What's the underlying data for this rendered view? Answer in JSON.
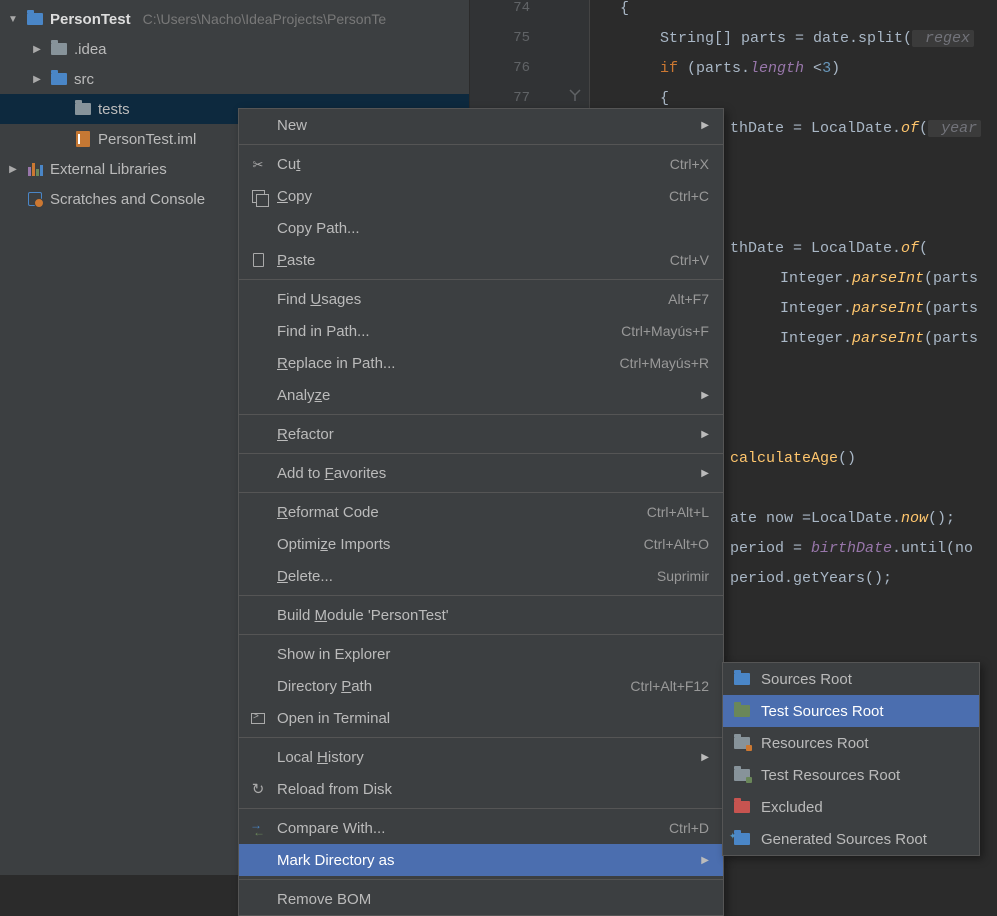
{
  "tree": {
    "root": {
      "name": "PersonTest",
      "path": "C:\\Users\\Nacho\\IdeaProjects\\PersonTe"
    },
    "items": [
      {
        "name": ".idea"
      },
      {
        "name": "src"
      },
      {
        "name": "tests"
      },
      {
        "name": "PersonTest.iml"
      }
    ],
    "libs": "External Libraries",
    "scratches": "Scratches and Console"
  },
  "gutter": {
    "ln74": "74",
    "ln75": "75",
    "ln76": "76",
    "ln77": "77"
  },
  "code": {
    "l74": {
      "brace": "{"
    },
    "l75": {
      "a": "String[] parts = date.split(",
      "hint": " regex"
    },
    "l76": {
      "kw": "if",
      "a": " (parts.",
      "field": "length",
      "b": " <",
      "num": "3",
      "c": ")"
    },
    "l77": {
      "brace": "{"
    },
    "l78": {
      "a": "thDate = LocalDate.",
      "fn": "of",
      "b": "(",
      "hint": " year"
    },
    "l82": {
      "a": "thDate = LocalDate.",
      "fn": "of",
      "b": "("
    },
    "l83": {
      "a": "Integer.",
      "fn": "parseInt",
      "b": "(parts"
    },
    "l84": {
      "a": "Integer.",
      "fn": "parseInt",
      "b": "(parts"
    },
    "l85": {
      "a": "Integer.",
      "fn": "parseInt",
      "b": "(parts"
    },
    "l90": {
      "fn": "calculateAge",
      "a": "()"
    },
    "l92": {
      "a": "ate now =LocalDate.",
      "fn": "now",
      "b": "();"
    },
    "l93": {
      "a": "period = ",
      "field": "birthDate",
      "b": ".until(no"
    },
    "l94": {
      "a": "period.getYears();"
    }
  },
  "menu": [
    {
      "type": "item",
      "label": "New",
      "sub": true
    },
    {
      "type": "sep"
    },
    {
      "type": "item",
      "label": "Cut",
      "mn": "t",
      "icon": "mi-cut",
      "sc": "Ctrl+X"
    },
    {
      "type": "item",
      "label": "Copy",
      "mn": "C",
      "icon": "mi-copy",
      "sc": "Ctrl+C"
    },
    {
      "type": "item",
      "label": "Copy Path...",
      "mn": ""
    },
    {
      "type": "item",
      "label": "Paste",
      "mn": "P",
      "icon": "mi-paste",
      "sc": "Ctrl+V"
    },
    {
      "type": "sep"
    },
    {
      "type": "item",
      "label": "Find Usages",
      "mn": "U",
      "sc": "Alt+F7"
    },
    {
      "type": "item",
      "label": "Find in Path...",
      "mn": "",
      "sc": "Ctrl+Mayús+F"
    },
    {
      "type": "item",
      "label": "Replace in Path...",
      "mn": "R",
      "sc": "Ctrl+Mayús+R"
    },
    {
      "type": "item",
      "label": "Analyze",
      "mn": "z",
      "sub": true
    },
    {
      "type": "sep"
    },
    {
      "type": "item",
      "label": "Refactor",
      "mn": "R",
      "sub": true
    },
    {
      "type": "sep"
    },
    {
      "type": "item",
      "label": "Add to Favorites",
      "mn": "F",
      "sub": true
    },
    {
      "type": "sep"
    },
    {
      "type": "item",
      "label": "Reformat Code",
      "mn": "R",
      "sc": "Ctrl+Alt+L"
    },
    {
      "type": "item",
      "label": "Optimize Imports",
      "mn": "z",
      "sc": "Ctrl+Alt+O"
    },
    {
      "type": "item",
      "label": "Delete...",
      "mn": "D",
      "sc": "Suprimir"
    },
    {
      "type": "sep"
    },
    {
      "type": "item",
      "label": "Build Module 'PersonTest'",
      "mn": "M"
    },
    {
      "type": "sep"
    },
    {
      "type": "item",
      "label": "Show in Explorer",
      "mn": ""
    },
    {
      "type": "item",
      "label": "Directory Path",
      "mn": "P",
      "sc": "Ctrl+Alt+F12"
    },
    {
      "type": "item",
      "label": "Open in Terminal",
      "icon": "mi-terminal"
    },
    {
      "type": "sep"
    },
    {
      "type": "item",
      "label": "Local History",
      "mn": "H",
      "sub": true
    },
    {
      "type": "item",
      "label": "Reload from Disk",
      "icon": "mi-reload"
    },
    {
      "type": "sep"
    },
    {
      "type": "item",
      "label": "Compare With...",
      "icon": "mi-compare",
      "sc": "Ctrl+D"
    },
    {
      "type": "item",
      "label": "Mark Directory as",
      "hover": true,
      "sub": true
    },
    {
      "type": "sep"
    },
    {
      "type": "item",
      "label": "Remove BOM"
    }
  ],
  "submenu": [
    {
      "label": "Sources Root",
      "cls": "sf-sources"
    },
    {
      "label": "Test Sources Root",
      "cls": "sf-test",
      "hover": true
    },
    {
      "label": "Resources Root",
      "cls": "sf-res"
    },
    {
      "label": "Test Resources Root",
      "cls": "sf-testres"
    },
    {
      "label": "Excluded",
      "cls": "sf-excl"
    },
    {
      "label": "Generated Sources Root",
      "cls": "sf-gen"
    }
  ]
}
